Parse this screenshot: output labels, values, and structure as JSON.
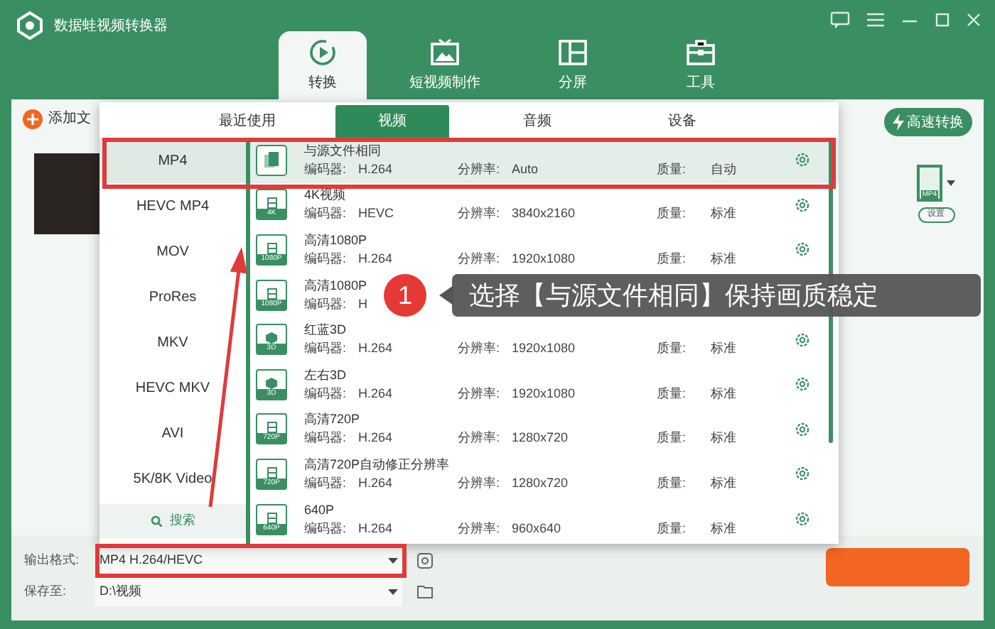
{
  "app": {
    "title": "数据蛙视频转换器"
  },
  "main_tabs": [
    {
      "label": "转换",
      "selected": true
    },
    {
      "label": "短视频制作",
      "selected": false
    },
    {
      "label": "分屏",
      "selected": false
    },
    {
      "label": "工具",
      "selected": false
    }
  ],
  "toolbar": {
    "add_file": "添加文",
    "fast_convert": "高速转换",
    "output_icon_label": "MP4",
    "settings": "设置"
  },
  "format_popup": {
    "tabs": [
      {
        "label": "最近使用",
        "selected": false
      },
      {
        "label": "视频",
        "selected": true
      },
      {
        "label": "音频",
        "selected": false
      },
      {
        "label": "设备",
        "selected": false
      }
    ],
    "formats": [
      {
        "label": "MP4",
        "selected": true
      },
      {
        "label": "HEVC MP4",
        "selected": false
      },
      {
        "label": "MOV",
        "selected": false
      },
      {
        "label": "ProRes",
        "selected": false
      },
      {
        "label": "MKV",
        "selected": false
      },
      {
        "label": "HEVC MKV",
        "selected": false
      },
      {
        "label": "AVI",
        "selected": false
      },
      {
        "label": "5K/8K Video",
        "selected": false
      }
    ],
    "search": "搜索",
    "presets": [
      {
        "kind": "same",
        "name": "与源文件相同",
        "codec_label": "编码器:",
        "codec": "H.264",
        "res_label": "分辨率:",
        "resolution": "Auto",
        "quality_label": "质量:",
        "quality": "自动",
        "selected": true
      },
      {
        "kind": "video",
        "badge": "4K",
        "name": "4K视频",
        "codec_label": "编码器:",
        "codec": "HEVC",
        "res_label": "分辨率:",
        "resolution": "3840x2160",
        "quality_label": "质量:",
        "quality": "标准",
        "selected": false
      },
      {
        "kind": "video",
        "badge": "1080P",
        "name": "高清1080P",
        "codec_label": "编码器:",
        "codec": "H.264",
        "res_label": "分辨率:",
        "resolution": "1920x1080",
        "quality_label": "质量:",
        "quality": "标准",
        "selected": false
      },
      {
        "kind": "video",
        "badge": "1080P",
        "name": "高清1080P",
        "codec_label": "编码器:",
        "codec": "H",
        "selected": false
      },
      {
        "kind": "stereo",
        "badge": "3D",
        "name": "红蓝3D",
        "codec_label": "编码器:",
        "codec": "H.264",
        "res_label": "分辨率:",
        "resolution": "1920x1080",
        "quality_label": "质量:",
        "quality": "标准",
        "selected": false
      },
      {
        "kind": "stereo",
        "badge": "3D",
        "name": "左右3D",
        "codec_label": "编码器:",
        "codec": "H.264",
        "res_label": "分辨率:",
        "resolution": "1920x1080",
        "quality_label": "质量:",
        "quality": "标准",
        "selected": false
      },
      {
        "kind": "video",
        "badge": "720P",
        "name": "高清720P",
        "codec_label": "编码器:",
        "codec": "H.264",
        "res_label": "分辨率:",
        "resolution": "1280x720",
        "quality_label": "质量:",
        "quality": "标准",
        "selected": false
      },
      {
        "kind": "video",
        "badge": "720P",
        "name": "高清720P自动修正分辨率",
        "codec_label": "编码器:",
        "codec": "H.264",
        "res_label": "分辨率:",
        "resolution": "1280x720",
        "quality_label": "质量:",
        "quality": "标准",
        "selected": false
      },
      {
        "kind": "video",
        "badge": "640P",
        "name": "640P",
        "codec_label": "编码器:",
        "codec": "H.264",
        "res_label": "分辨率:",
        "resolution": "960x640",
        "quality_label": "质量:",
        "quality": "标准",
        "selected": false
      }
    ]
  },
  "output_format": {
    "label": "输出格式:",
    "value": "MP4 H.264/HEVC"
  },
  "save_to": {
    "label": "保存至:",
    "value": "D:\\视频"
  },
  "annotation": {
    "step": "1",
    "text": "选择【与源文件相同】保持画质稳定"
  }
}
